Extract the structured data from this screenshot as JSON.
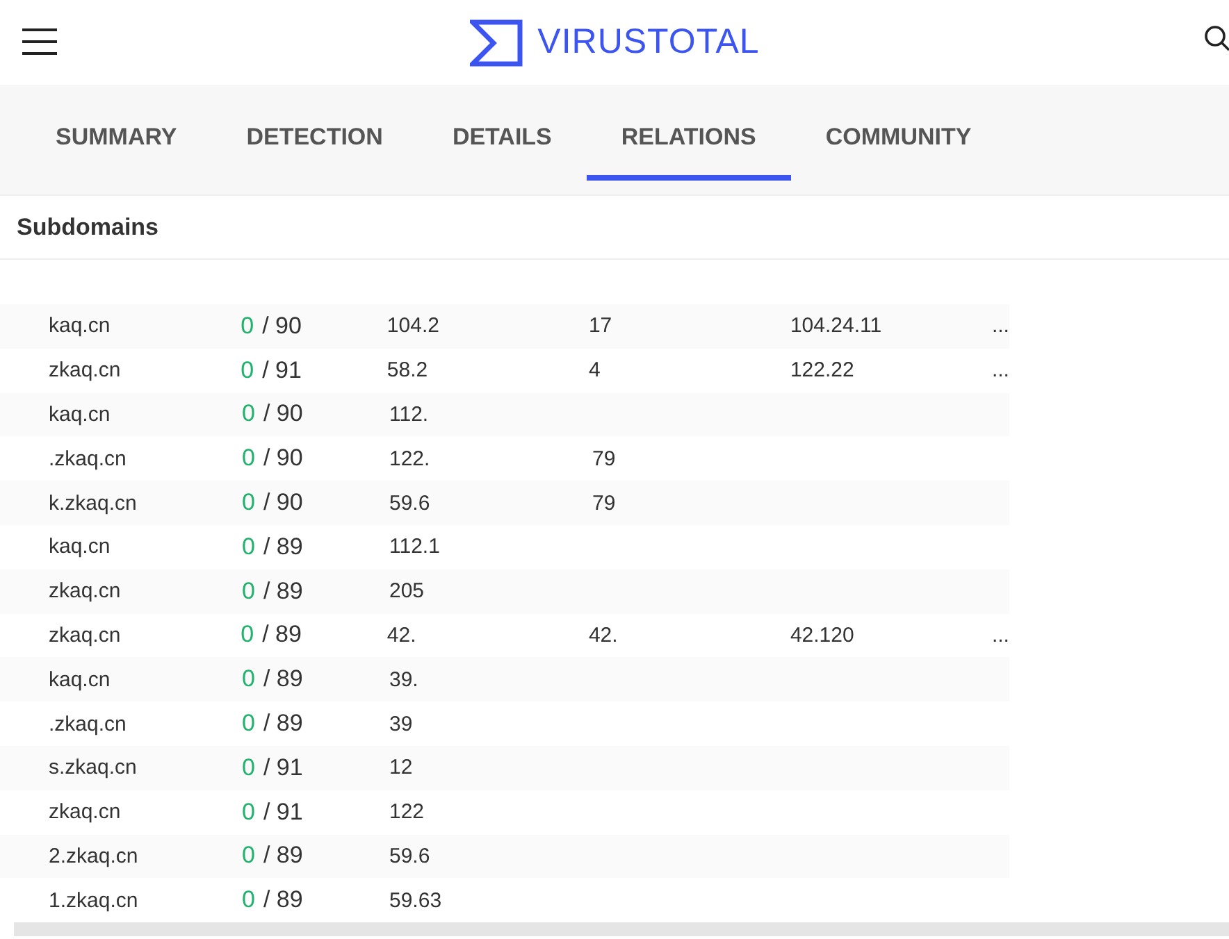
{
  "header": {
    "brand": "VIRUSTOTAL"
  },
  "tabs": [
    {
      "label": "SUMMARY",
      "selected": false
    },
    {
      "label": "DETECTION",
      "selected": false
    },
    {
      "label": "DETAILS",
      "selected": false
    },
    {
      "label": "RELATIONS",
      "selected": true
    },
    {
      "label": "COMMUNITY",
      "selected": false
    }
  ],
  "section": {
    "title": "Subdomains"
  },
  "rows": [
    {
      "domain": "kaq.cn",
      "detected": "0",
      "total": "/ 90",
      "ip_1": "104.2",
      "ip_2": "17",
      "ip_3": "104.24.11",
      "more": "..."
    },
    {
      "domain": "zkaq.cn",
      "detected": "0",
      "total": "/ 91",
      "ip_1": "58.2",
      "ip_2": "4",
      "ip_3": "122.22",
      "more": "..."
    },
    {
      "domain": "kaq.cn",
      "detected": "0",
      "total": "/ 90",
      "ip_1": "112."
    },
    {
      "domain": ".zkaq.cn",
      "detected": "0",
      "total": "/ 90",
      "ip_1": "122.",
      "ip_2": "79"
    },
    {
      "domain": "k.zkaq.cn",
      "detected": "0",
      "total": "/ 90",
      "ip_1": "59.6",
      "ip_2": "79"
    },
    {
      "domain": "kaq.cn",
      "detected": "0",
      "total": "/ 89",
      "ip_1": "112.1"
    },
    {
      "domain": "zkaq.cn",
      "detected": "0",
      "total": "/ 89",
      "ip_1": "205"
    },
    {
      "domain": "zkaq.cn",
      "detected": "0",
      "total": "/ 89",
      "ip_1": "42.",
      "ip_2": "42.",
      "ip_3": "42.120",
      "more": "..."
    },
    {
      "domain": "kaq.cn",
      "detected": "0",
      "total": "/ 89",
      "ip_1": "39."
    },
    {
      "domain": ".zkaq.cn",
      "detected": "0",
      "total": "/ 89",
      "ip_1": "39"
    },
    {
      "domain": "s.zkaq.cn",
      "detected": "0",
      "total": "/ 91",
      "ip_1": "12"
    },
    {
      "domain": "zkaq.cn",
      "detected": "0",
      "total": "/ 91",
      "ip_1": "122"
    },
    {
      "domain": "2.zkaq.cn",
      "detected": "0",
      "total": "/ 89",
      "ip_1": "59.6"
    },
    {
      "domain": "1.zkaq.cn",
      "detected": "0",
      "total": "/ 89",
      "ip_1": "59.63"
    }
  ]
}
